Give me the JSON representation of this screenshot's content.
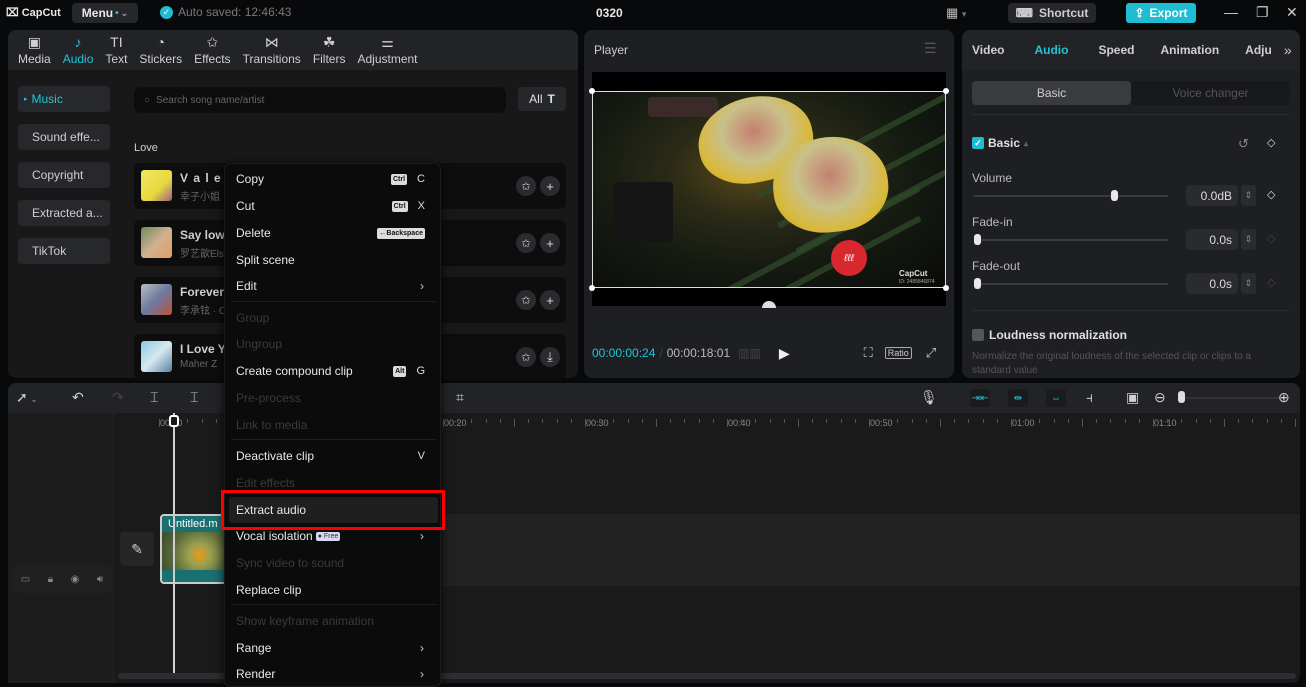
{
  "titlebar": {
    "logo": "CapCut",
    "menu_label": "Menu",
    "autosave": "Auto saved: 12:46:43",
    "project_title": "0320",
    "shortcut_label": "Shortcut",
    "export_label": "Export"
  },
  "media_tabs": [
    {
      "label": "Media",
      "icon": "media-icon"
    },
    {
      "label": "Audio",
      "icon": "audio-icon",
      "active": true
    },
    {
      "label": "Text",
      "icon": "text-icon"
    },
    {
      "label": "Stickers",
      "icon": "stickers-icon"
    },
    {
      "label": "Effects",
      "icon": "effects-icon"
    },
    {
      "label": "Transitions",
      "icon": "transitions-icon"
    },
    {
      "label": "Filters",
      "icon": "filters-icon"
    },
    {
      "label": "Adjustment",
      "icon": "adjustment-icon"
    }
  ],
  "audio_sidebar": [
    {
      "label": "Music",
      "active": true
    },
    {
      "label": "Sound effe..."
    },
    {
      "label": "Copyright"
    },
    {
      "label": "Extracted a..."
    },
    {
      "label": "TikTok"
    }
  ],
  "search": {
    "placeholder": "Search song name/artist"
  },
  "filter_label": "All",
  "section_label": "Love",
  "songs": [
    {
      "title": "V a l e",
      "artist": "幸子小姐"
    },
    {
      "title": "Say low",
      "artist": "罗艺歆Else"
    },
    {
      "title": "Forever",
      "artist": "李承铉 · C"
    },
    {
      "title": "I Love Y",
      "artist": "Maher Z"
    }
  ],
  "player": {
    "title": "Player",
    "current_time": "00:00:00:24",
    "total_time": "00:00:18:01",
    "ratio_label": "Ratio",
    "watermark": "CapCut",
    "watermark_id": "ID: 2485846874"
  },
  "properties": {
    "tabs": [
      {
        "label": "Video"
      },
      {
        "label": "Audio",
        "active": true
      },
      {
        "label": "Speed"
      },
      {
        "label": "Animation"
      },
      {
        "label": "Adju"
      }
    ],
    "sub_tabs": [
      {
        "label": "Basic",
        "active": true
      },
      {
        "label": "Voice changer"
      }
    ],
    "basic_section": "Basic",
    "volume_label": "Volume",
    "volume_value": "0.0dB",
    "volume_level": 0.72,
    "fade_in_label": "Fade-in",
    "fade_in_value": "0.0s",
    "fade_out_label": "Fade-out",
    "fade_out_value": "0.0s",
    "loudness_label": "Loudness normalization",
    "loudness_desc": "Normalize the original loudness of the selected clip or clips to a standard value"
  },
  "timeline": {
    "ruler": [
      "00:00",
      "00:20",
      "00:30",
      "00:40",
      "00:50",
      "01:00",
      "01:10"
    ],
    "clip_title": "Untitled.m"
  },
  "context_menu": {
    "items": [
      {
        "label": "Copy",
        "kbd": "Ctrl",
        "key": "C"
      },
      {
        "label": "Cut",
        "kbd": "Ctrl",
        "key": "X"
      },
      {
        "label": "Delete",
        "kbd": "←Backspace"
      },
      {
        "label": "Split scene"
      },
      {
        "label": "Edit",
        "submenu": true
      },
      {
        "label": "Group",
        "disabled": true
      },
      {
        "label": "Ungroup",
        "disabled": true
      },
      {
        "label": "Create compound clip",
        "kbd": "Alt",
        "key": "G"
      },
      {
        "label": "Pre-process",
        "disabled": true
      },
      {
        "label": "Link to media",
        "disabled": true
      },
      {
        "label": "Deactivate clip",
        "key": "V"
      },
      {
        "label": "Edit effects",
        "disabled": true
      },
      {
        "label": "Extract audio",
        "highlighted": true
      },
      {
        "label": "Vocal isolation",
        "badge": "Free",
        "submenu": true
      },
      {
        "label": "Sync video to sound",
        "disabled": true
      },
      {
        "label": "Replace clip"
      },
      {
        "label": "Show keyframe animation",
        "disabled": true
      },
      {
        "label": "Range",
        "submenu": true
      },
      {
        "label": "Render",
        "submenu": true
      }
    ]
  },
  "colors": {
    "accent": "#1fc6d8",
    "highlight_box": "#ff0000",
    "export": "#1fbcd2"
  }
}
